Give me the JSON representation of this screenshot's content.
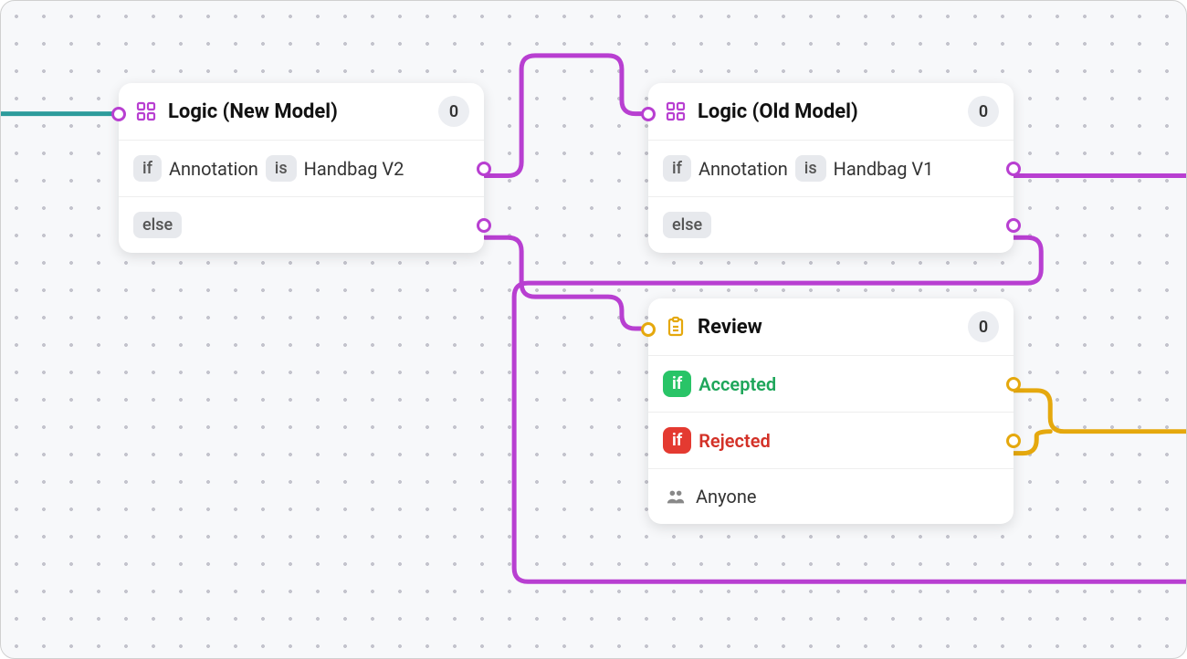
{
  "canvas": {
    "accent_purple": "#b83fd1",
    "accent_gold": "#e5a80d",
    "accent_teal": "#2d9c9c"
  },
  "nodes": {
    "logic_new": {
      "title": "Logic (New Model)",
      "count": "0",
      "rows": {
        "annotation_key": "if",
        "annotation_field": "Annotation",
        "annotation_op": "is",
        "annotation_value": "Handbag V2",
        "else_label": "else"
      }
    },
    "logic_old": {
      "title": "Logic (Old Model)",
      "count": "0",
      "rows": {
        "annotation_key": "if",
        "annotation_field": "Annotation",
        "annotation_op": "is",
        "annotation_value": "Handbag V1",
        "else_label": "else"
      }
    },
    "review": {
      "title": "Review",
      "count": "0",
      "rows": {
        "accepted_key": "if",
        "accepted_label": "Accepted",
        "rejected_key": "if",
        "rejected_label": "Rejected",
        "anyone_label": "Anyone"
      }
    }
  }
}
